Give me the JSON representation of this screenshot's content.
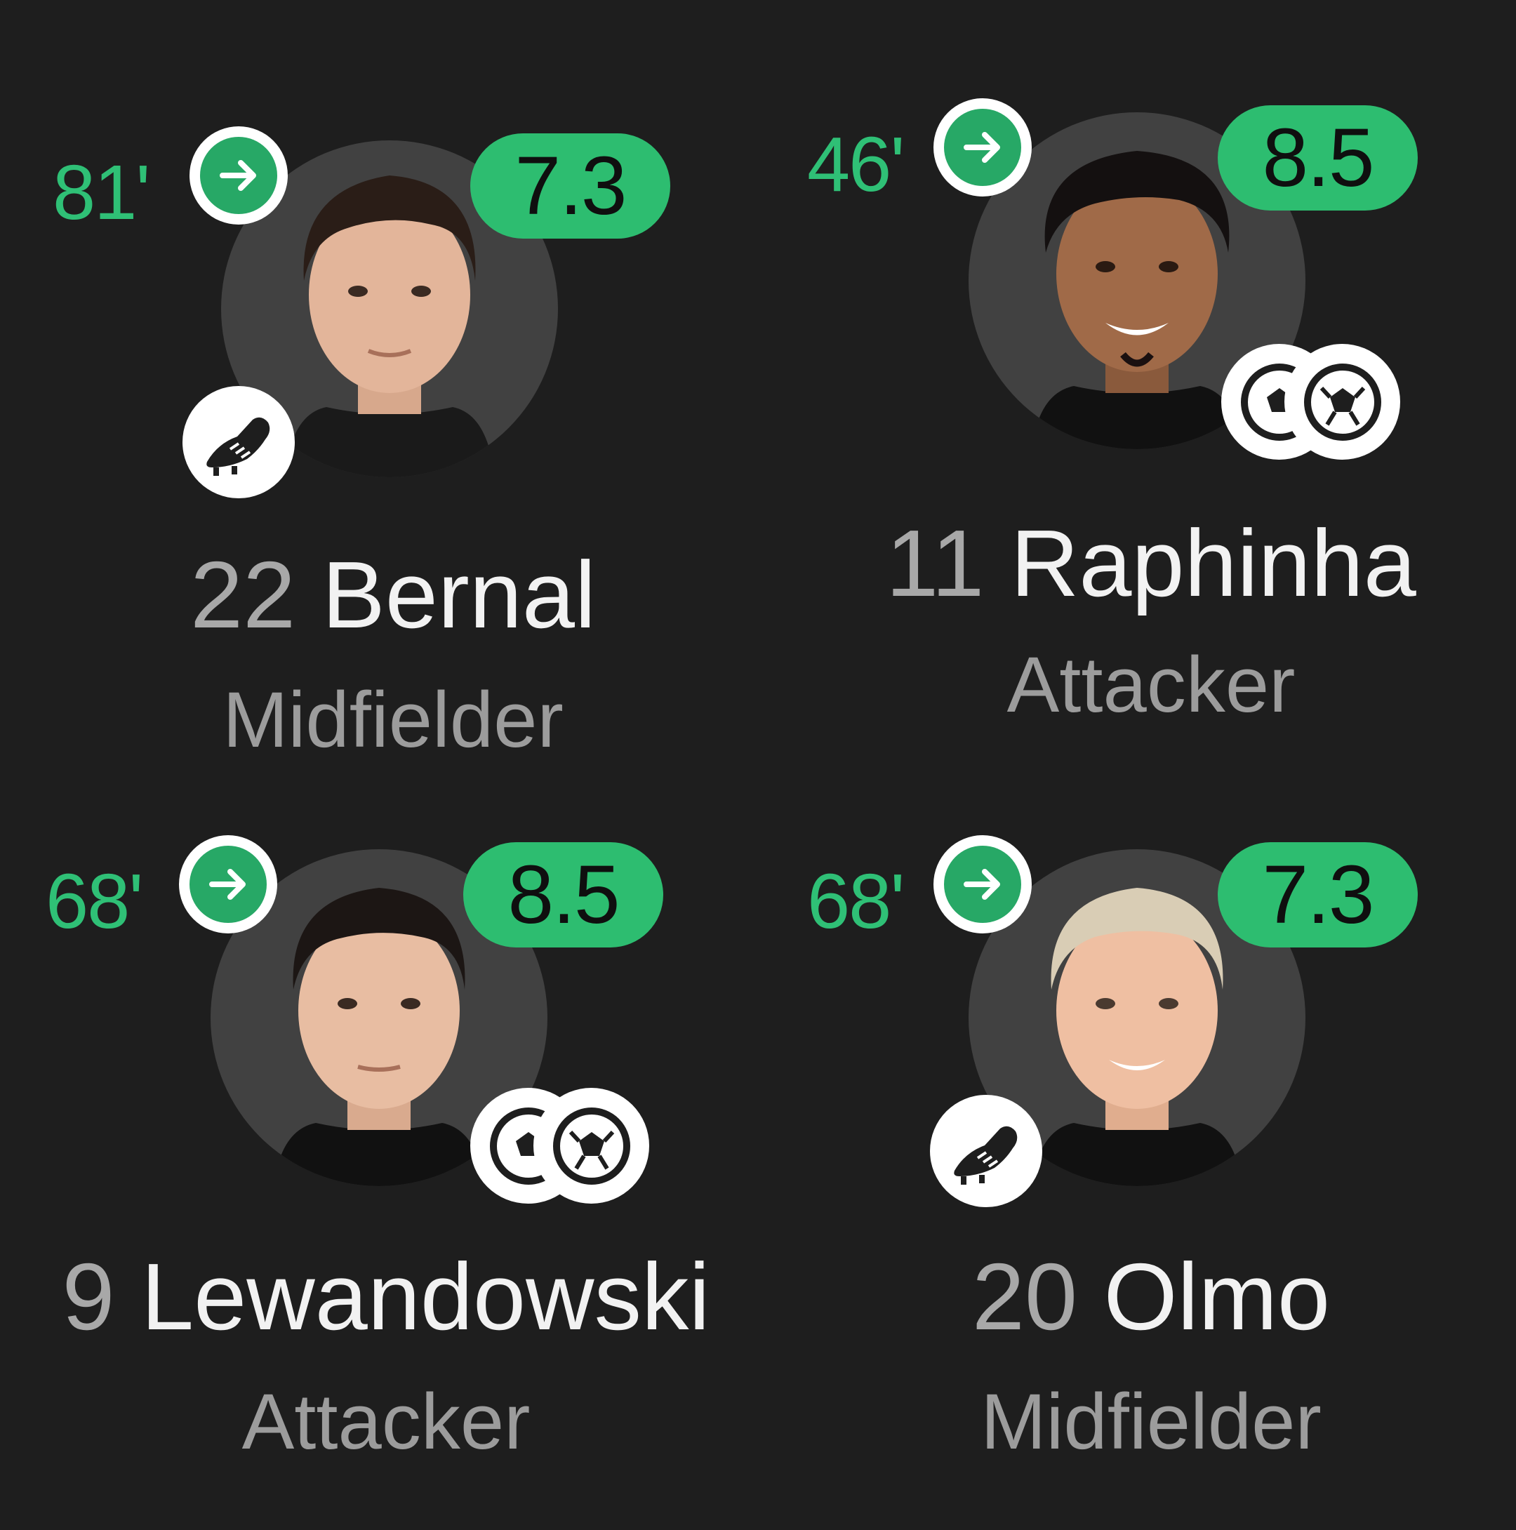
{
  "players": [
    {
      "sub_minute": "81'",
      "rating": "7.3",
      "number": "22",
      "surname": "Bernal",
      "position": "Midfielder",
      "event_icon": "boot-icon"
    },
    {
      "sub_minute": "46'",
      "rating": "8.5",
      "number": "11",
      "surname": "Raphinha",
      "position": "Attacker",
      "event_icon": "two-goals-icon"
    },
    {
      "sub_minute": "68'",
      "rating": "8.5",
      "number": "9",
      "surname": "Lewandowski",
      "position": "Attacker",
      "event_icon": "two-goals-icon"
    },
    {
      "sub_minute": "68'",
      "rating": "7.3",
      "number": "20",
      "surname": "Olmo",
      "position": "Midfielder",
      "event_icon": "boot-icon"
    }
  ],
  "colors": {
    "background": "#1e1e1e",
    "accent_green": "#2dbd70",
    "avatar_circle": "#414141",
    "name_text": "#f2f2f2",
    "secondary_text": "#9c9c9c"
  }
}
